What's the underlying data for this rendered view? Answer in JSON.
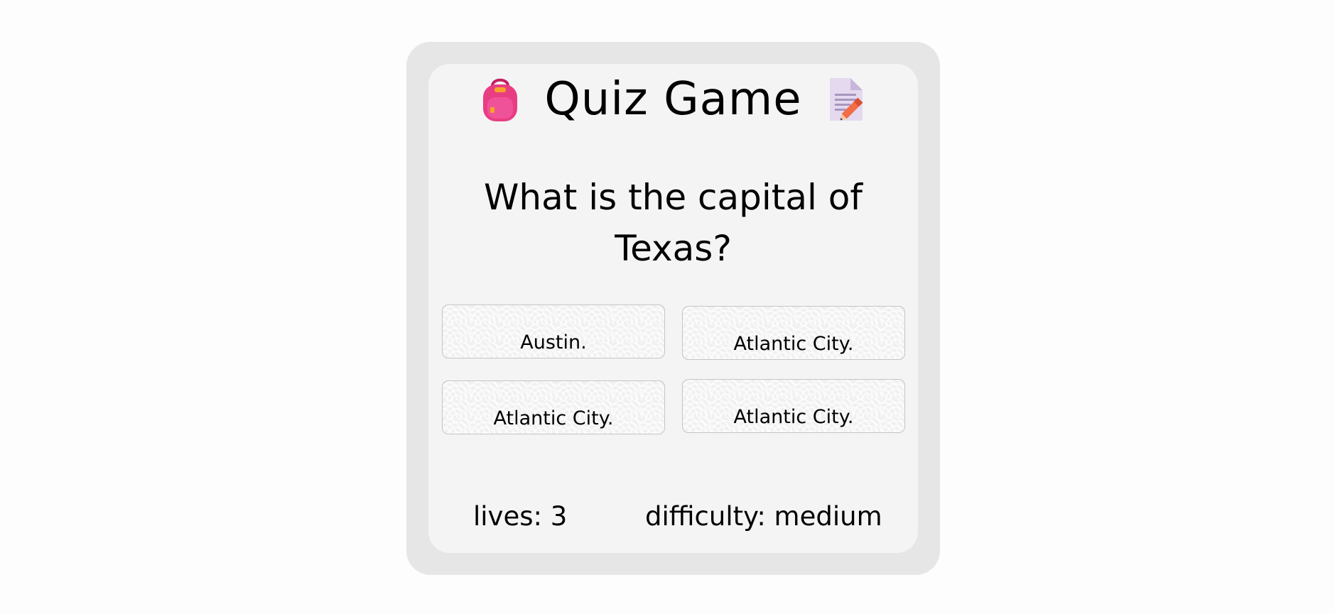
{
  "header": {
    "title": "Quiz Game",
    "left_icon": "backpack-icon",
    "right_icon": "memo-icon"
  },
  "question": {
    "text": "What is the capital of Texas?"
  },
  "answers": [
    {
      "label": "Austin."
    },
    {
      "label": "Atlantic City."
    },
    {
      "label": "Atlantic City."
    },
    {
      "label": "Atlantic City."
    }
  ],
  "status": {
    "lives_text": "lives: 3",
    "difficulty_text": "difficulty: medium"
  },
  "colors": {
    "outer_frame": "#e6e6e6",
    "card": "#f4f4f4",
    "page_background": "#fdfdfd",
    "backpack": "#e93d82",
    "pencil": "#f26d45"
  }
}
